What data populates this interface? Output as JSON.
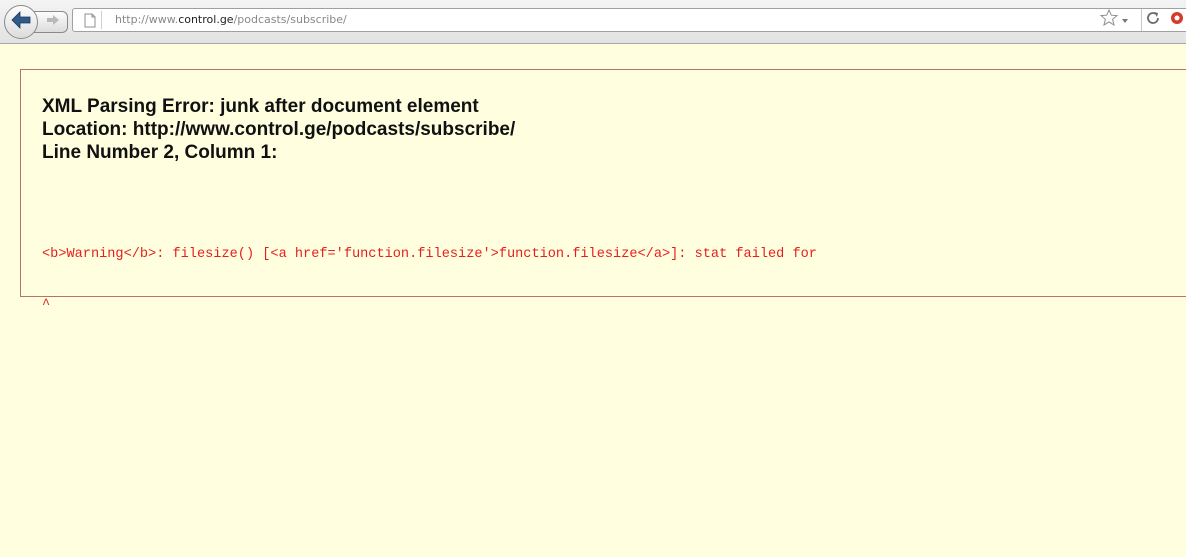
{
  "browser": {
    "url_prefix": "http://www.",
    "url_host": "control.ge",
    "url_path": "/podcasts/subscribe/"
  },
  "error": {
    "title_line": "XML Parsing Error: junk after document element",
    "location_line": "Location: http://www.control.ge/podcasts/subscribe/",
    "position_line": "Line Number 2, Column 1:",
    "source_line": "<b>Warning</b>:  filesize() [<a href='function.filesize'>function.filesize</a>]: stat failed for",
    "caret_line": "^"
  },
  "colors": {
    "page_background": "#ffffe0",
    "error_text": "#e61e1e",
    "box_border": "#b87070"
  },
  "icons": {
    "back": "back-arrow-icon",
    "forward": "forward-arrow-icon",
    "page": "page-icon",
    "bookmark": "star-icon",
    "dropdown": "chevron-down-icon",
    "reload": "reload-icon",
    "addon": "addon-icon"
  }
}
